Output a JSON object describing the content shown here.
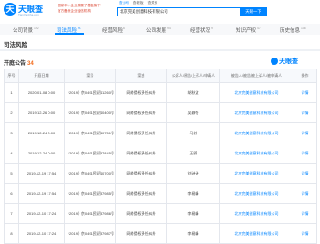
{
  "header": {
    "logo_mark": "天",
    "logo_text": "天眼查",
    "logo_sub": "TianYanCha.com",
    "badge_line1": "国家中小企业发展子基金旗下",
    "badge_line2": "官方备案企业征信机构",
    "search_tabs": [
      "查公司",
      "查老板",
      "查关系"
    ],
    "search_value": "北京完美创意科技有限公司",
    "search_button": "天眼一下"
  },
  "nav": {
    "tabs": [
      {
        "label": "公司背景",
        "count": "192"
      },
      {
        "label": "司法风险",
        "count": "91"
      },
      {
        "label": "经营风险",
        "count": "6"
      },
      {
        "label": "公司发展",
        "count": "94"
      },
      {
        "label": "经营状况",
        "count": "9"
      },
      {
        "label": "知识产权",
        "count": "47"
      },
      {
        "label": "历史信息",
        "count": "106"
      }
    ]
  },
  "section_title": "司法风险",
  "notice": {
    "title": "开庭公告",
    "count": "34",
    "watermark": "天眼查"
  },
  "table": {
    "headers": [
      "序号",
      "开庭日期",
      "案号",
      "案由",
      "公诉人/原告/上诉人/申请人",
      "被告人/被告/被上诉人/被申请人",
      "操作"
    ],
    "rows": [
      {
        "index": "1",
        "date": "2020-01-08 0:00",
        "case_no": "（2019）京0491民初41260号",
        "cause": "网络侵权责任纠纷",
        "plaintiff": "胡秋波",
        "defendant": "北京完美创意科技有限公司",
        "action": "详情"
      },
      {
        "index": "2",
        "date": "2019-12-26 0:00",
        "case_no": "（2019）京0491民初40400号",
        "cause": "网络侵权责任纠纷",
        "plaintiff": "吴静怡",
        "defendant": "北京完美创意科技有限公司",
        "action": "详情"
      },
      {
        "index": "3",
        "date": "2019-12-24 0:00",
        "case_no": "（2019）京0491民初40751号",
        "cause": "网络侵权责任纠纷",
        "plaintiff": "马苏",
        "defendant": "北京完美创意科技有限公司",
        "action": "详情"
      },
      {
        "index": "4",
        "date": "2019-12-24 0:00",
        "case_no": "（2019）京0491民初37845号",
        "cause": "网络侵权责任纠纷",
        "plaintiff": "王鸥",
        "defendant": "北京完美创意科技有限公司",
        "action": "详情"
      },
      {
        "index": "5",
        "date": "2019-12-19 17:54",
        "case_no": "（2019）京0491民初40700号",
        "cause": "网络侵权责任纠纷",
        "plaintiff": "刘诗诗",
        "defendant": "北京完美创意科技有限公司",
        "action": "详情"
      },
      {
        "index": "6",
        "date": "2019-12-19 17:54",
        "case_no": "（2019）京0491民初37985号",
        "cause": "网络侵权责任纠纷",
        "plaintiff": "李易峰",
        "defendant": "北京完美创意科技有限公司",
        "action": "详情"
      },
      {
        "index": "7",
        "date": "2019-12-10 17:24",
        "case_no": "（2019）京0491民初37986号",
        "cause": "网络侵权责任纠纷",
        "plaintiff": "李易峰",
        "defendant": "北京完美创意科技有限公司",
        "action": "详情"
      },
      {
        "index": "8",
        "date": "2019-12-10 17:24",
        "case_no": "（2019）京0491民初37987号",
        "cause": "网络侵权责任纠纷",
        "plaintiff": "李易峰",
        "defendant": "北京完美创意科技有限公司",
        "action": "详情"
      }
    ]
  }
}
